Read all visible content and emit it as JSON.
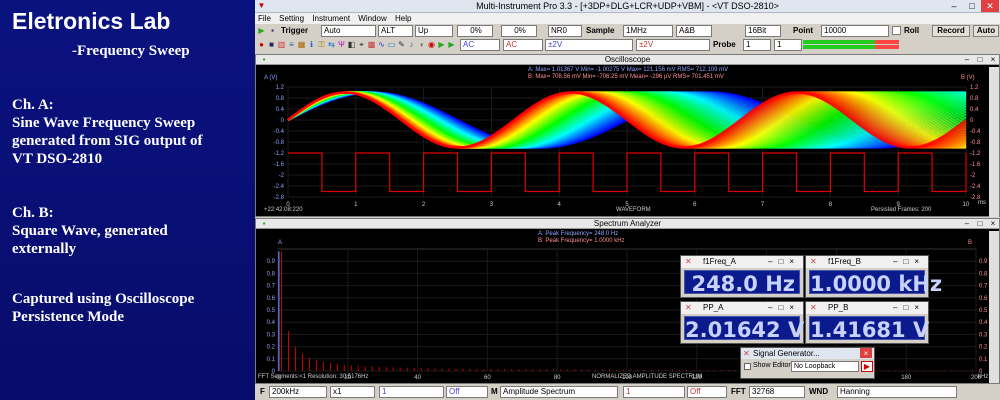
{
  "caption": {
    "title": "Eletronics Lab",
    "subtitle": "-Frequency Sweep",
    "cha_heading": "Ch. A:",
    "cha_line1": "Sine Wave Frequency Sweep",
    "cha_line2": "generated from SIG output of",
    "cha_line3": "VT DSO-2810",
    "chb_heading": "Ch. B:",
    "chb_line1": "Square Wave, generated",
    "chb_line2": "externally",
    "cap_line1": "Captured using Oscilloscope",
    "cap_line2": "Persistence Mode"
  },
  "window": {
    "title": "Multi-Instrument Pro 3.3     -  [+3DP+DLG+LCR+UDP+VBM]   -  <VT DSO-2810>",
    "minimize": "–",
    "maximize": "□",
    "close": "✕"
  },
  "menu": [
    "File",
    "Setting",
    "Instrument",
    "Window",
    "Help"
  ],
  "toolbar1": {
    "trigger_label": "Trigger",
    "trigger_mode": "Auto",
    "trigger_source": "ALT",
    "trigger_edge": "Up",
    "pretrig": "0%",
    "level": "0%",
    "nr": "NR0",
    "sample_label": "Sample",
    "sample_rate": "1MHz",
    "channels": "A&B",
    "bits": "16Bit",
    "point_label": "Point",
    "points": "10000",
    "roll_label": "Roll",
    "record_label": "Record",
    "auto_label": "Auto"
  },
  "toolbar2": {
    "chA_coupling": "AC",
    "chA_range": "±2V",
    "chB_coupling": "AC",
    "chB_range": "±2V",
    "probe_label": "Probe",
    "probe_a": "1",
    "probe_b": "1"
  },
  "oscilloscope": {
    "title": "Oscilloscope",
    "stats_a": "A:  Max=     1.01367   V  Min=    -1.00275   V  Max=      121.156  mV  RMS=      712.109  mV",
    "stats_b": "B:  Max=     708.56  mV  Min=    -706.25  mV  Mean=         -296    µV  RMS=      701.451  mV",
    "left_unit": "A (V)",
    "right_unit": "B (V)",
    "y_ticks_left": [
      "1.2",
      "0.8",
      "0.4",
      "0",
      "-0.4",
      "-0.8",
      "-1.2",
      "-1.6",
      "-2",
      "-2.4",
      "-2.8"
    ],
    "y_ticks_right": [
      "1.2",
      "0.8",
      "0.4",
      "0",
      "-0.4",
      "-0.8",
      "-1.2",
      "-1.6",
      "-2",
      "-2.4",
      "-2.8"
    ],
    "x_ticks": [
      "0",
      "1",
      "2",
      "3",
      "4",
      "5",
      "6",
      "7",
      "8",
      "9",
      "10"
    ],
    "x_unit": "ms",
    "timestamp": "+22:42:08:220",
    "xlabel": "WAVEFORM",
    "persisted": "Persisted Frames: 200"
  },
  "spectrum": {
    "title": "Spectrum Analyzer",
    "peak_a": "A: Peak Frequency=         248.0    Hz",
    "peak_b": "B: Peak Frequency=        1.0000    kHz",
    "left_unit": "A",
    "right_unit": "B",
    "y_ticks_left": [
      "0.9",
      "0.8",
      "0.7",
      "0.6",
      "0.5",
      "0.4",
      "0.3",
      "0.2",
      "0.1",
      "0"
    ],
    "y_ticks_right": [
      "0.9",
      "0.8",
      "0.7",
      "0.6",
      "0.5",
      "0.4",
      "0.3",
      "0.2",
      "0.1",
      "0"
    ],
    "x_ticks": [
      "0",
      "20",
      "40",
      "60",
      "80",
      "100",
      "120",
      "140",
      "160",
      "180",
      "200"
    ],
    "x_unit": "kHz",
    "fft_info": "FFT Segments:<1      Resolution: 30.5176Hz",
    "xlabel": "NORMALIZED AMPLITUDE SPECTRUM"
  },
  "readouts": [
    {
      "name": "f1Freq_A",
      "value": "248.0 Hz"
    },
    {
      "name": "f1Freq_B",
      "value": "1.0000 kHz"
    },
    {
      "name": "PP_A",
      "value": "2.01642 V"
    },
    {
      "name": "PP_B",
      "value": "1.41681 V"
    }
  ],
  "siggen": {
    "title": "Signal Generator...",
    "show_editor": "Show Editor",
    "loopback": "No Loopback"
  },
  "bottombar": {
    "f_label": "F",
    "f_value": "200kHz",
    "zoom": "x1",
    "chan_a": "1",
    "off_a": "Off",
    "m_label": "M",
    "mode": "Amplitude Spectrum",
    "chan_b": "1",
    "off_b": "Off",
    "fft_label": "FFT",
    "fft_size": "32768",
    "wnd_label": "WND",
    "window": "Hanning"
  },
  "colors": {
    "caption_bg": "#0a1280",
    "trace_b": "#e00000",
    "readout_bg": "#0b1a8c",
    "readout_fg": "#c8d2ff"
  }
}
